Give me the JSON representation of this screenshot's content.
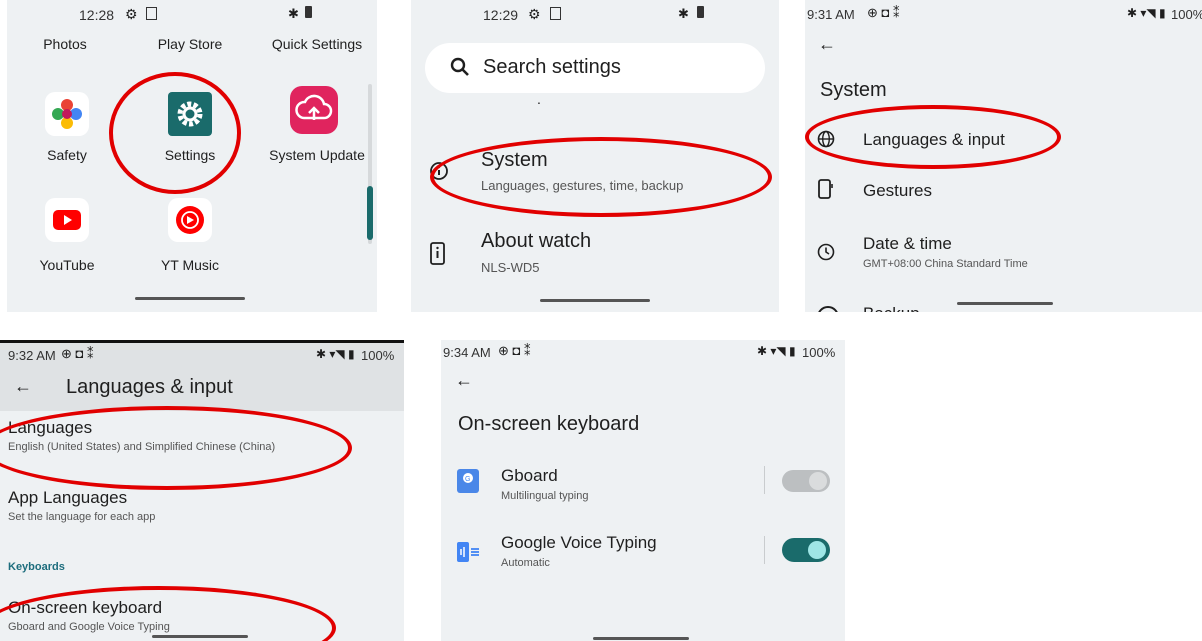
{
  "panel1": {
    "status": {
      "time": "12:28"
    },
    "top_labels": [
      "Photos",
      "Play Store",
      "Quick Settings"
    ],
    "apps_row1": [
      "Safety",
      "Settings",
      "System Update"
    ],
    "apps_row2": [
      "YouTube",
      "YT Music"
    ]
  },
  "panel2": {
    "status": {
      "time": "12:29"
    },
    "search_placeholder": "Search settings",
    "dot": ".",
    "items": [
      {
        "title": "System",
        "subtitle": "Languages, gestures, time, backup"
      },
      {
        "title": "About watch",
        "subtitle": "NLS-WD5"
      }
    ]
  },
  "panel3": {
    "status": {
      "time": "9:31 AM",
      "battery": "100%"
    },
    "header": "System",
    "items": [
      {
        "title": "Languages & input"
      },
      {
        "title": "Gestures"
      },
      {
        "title": "Date & time",
        "subtitle": "GMT+08:00 China Standard Time"
      },
      {
        "title": "Backup"
      }
    ]
  },
  "panel4": {
    "status": {
      "time": "9:32 AM",
      "battery": "100%"
    },
    "title": "Languages & input",
    "items": [
      {
        "title": "Languages",
        "subtitle": "English (United States) and Simplified Chinese (China)"
      },
      {
        "title": "App Languages",
        "subtitle": "Set the language for each app"
      }
    ],
    "section": "Keyboards",
    "keyboard": {
      "title": "On-screen keyboard",
      "subtitle": "Gboard and Google Voice Typing"
    }
  },
  "panel5": {
    "status": {
      "time": "9:34 AM",
      "battery": "100%"
    },
    "title": "On-screen keyboard",
    "items": [
      {
        "title": "Gboard",
        "subtitle": "Multilingual typing",
        "enabled": false
      },
      {
        "title": "Google Voice Typing",
        "subtitle": "Automatic",
        "enabled": true
      }
    ]
  },
  "colors": {
    "accent": "#1a6b6b",
    "annotation": "#e10000",
    "teal_section": "#1d6d7d"
  }
}
